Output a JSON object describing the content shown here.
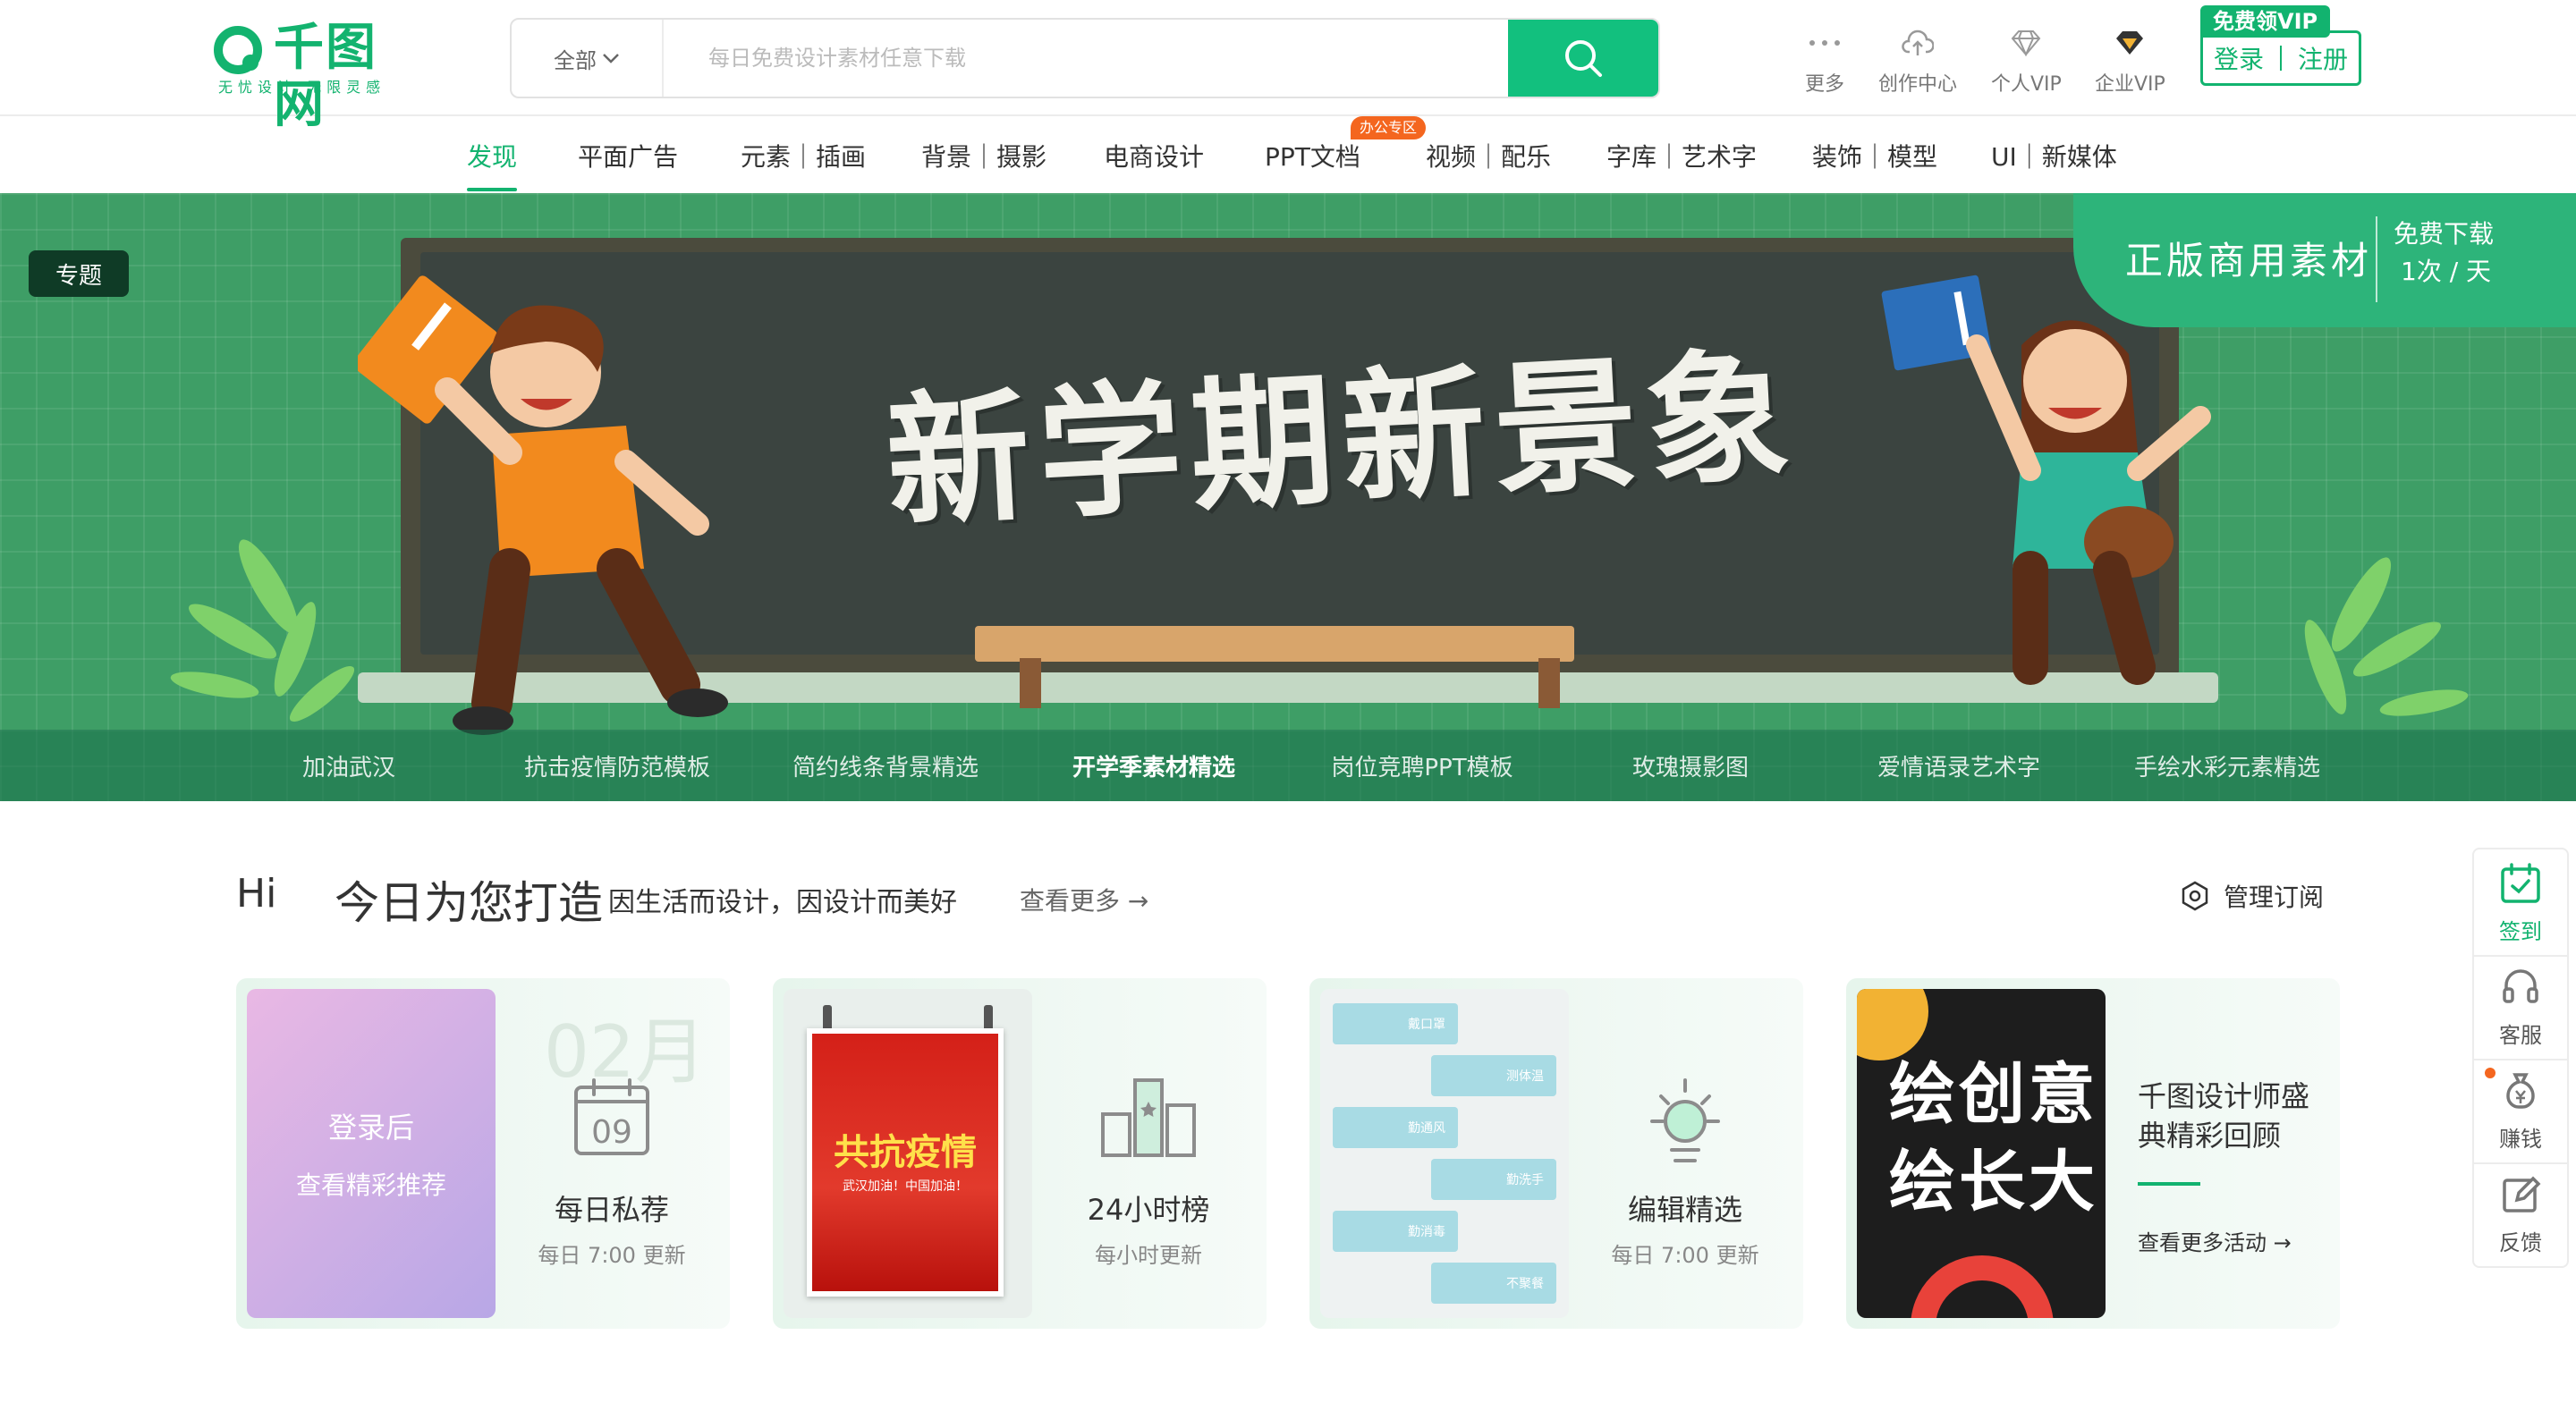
{
  "header": {
    "logo": {
      "brand": "千图网",
      "tagline": "无忧设计 无限灵感"
    },
    "search": {
      "category": "全部",
      "placeholder": "每日免费设计素材任意下载"
    },
    "nav": [
      {
        "label": "更多",
        "icon": "more-dots-icon"
      },
      {
        "label": "创作中心",
        "icon": "upload-cloud-icon"
      },
      {
        "label": "个人VIP",
        "icon": "diamond-icon"
      },
      {
        "label": "企业VIP",
        "icon": "diamond-filled-icon"
      }
    ],
    "vip_tag": "免费领VIP",
    "login": "登录",
    "register": "注册"
  },
  "category_nav": {
    "items": [
      "发现",
      "平面广告",
      "元素｜插画",
      "背景｜摄影",
      "电商设计",
      "PPT文档",
      "视频｜配乐",
      "字库｜艺术字",
      "装饰｜模型",
      "UI｜新媒体"
    ],
    "active": "发现",
    "badge": "办公专区"
  },
  "banner": {
    "chip": "专题",
    "headline": "新学期新景象",
    "promo": {
      "title": "正版商用素材",
      "line1": "免费下载",
      "line2": "1次 / 天"
    },
    "tabs": [
      "加油武汉",
      "抗击疫情防范模板",
      "简约线条背景精选",
      "开学季素材精选",
      "岗位竞聘PPT模板",
      "玫瑰摄影图",
      "爱情语录艺术字",
      "手绘水彩元素精选"
    ],
    "active_tab": "开学季素材精选",
    "colors": {
      "bg": "#3e9e66",
      "board": "#3b4440",
      "promo": "#2db47a"
    }
  },
  "section": {
    "hi": "Hi",
    "title": "今日为您打造",
    "subtitle": "因生活而设计，因设计而美好",
    "more": "查看更多 →",
    "manage": "管理订阅"
  },
  "cards": [
    {
      "thumb_line1": "登录后",
      "thumb_line2": "查看精彩推荐",
      "month": "02月",
      "day": "09",
      "title": "每日私荐",
      "sub": "每日 7:00 更新"
    },
    {
      "poster_text": "共抗疫情",
      "poster_sub": "武汉加油！中国加油！",
      "title": "24小时榜",
      "sub": "每小时更新"
    },
    {
      "tags": [
        "戴口罩",
        "测体温",
        "勤通风",
        "勤洗手",
        "勤消毒",
        "不聚餐"
      ],
      "title": "编辑精选",
      "sub": "每日 7:00 更新"
    },
    {
      "art_line1": "绘创意",
      "art_line2": "绘长大",
      "title_line1": "千图设计师盛",
      "title_line2": "典精彩回顾",
      "more": "查看更多活动 →"
    }
  ],
  "sidebar": [
    {
      "label": "签到",
      "icon": "calendar-check-icon"
    },
    {
      "label": "客服",
      "icon": "headset-icon"
    },
    {
      "label": "赚钱",
      "icon": "money-bag-icon"
    },
    {
      "label": "反馈",
      "icon": "edit-icon"
    }
  ],
  "theme": {
    "accent": "#12b36f",
    "search_button": "#12c07e",
    "badge": "#f4661f"
  }
}
